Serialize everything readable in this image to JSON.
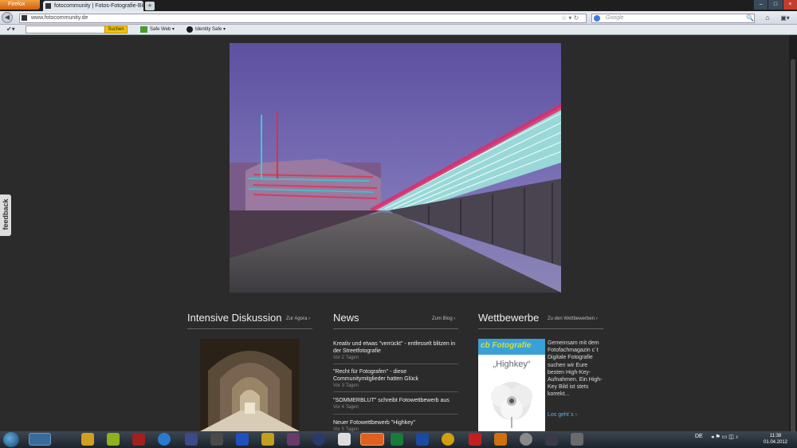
{
  "browser": {
    "app_button": "Firefox",
    "tab_title": "fotocommunity | Fotos-Fotografie-Bilde...",
    "new_tab": "+",
    "url": "www.fotocommunity.de",
    "search_placeholder": "Google"
  },
  "toolbar": {
    "search_button": "Suchen",
    "safe_web": "Safe Web ▾",
    "identity_safe": "Identity Safe ▾"
  },
  "page": {
    "feedback_tab": "feedback",
    "sections": {
      "discussion": {
        "title": "Intensive Diskussion",
        "link": "Zur Agora"
      },
      "news": {
        "title": "News",
        "link": "Zum Blog"
      },
      "contests": {
        "title": "Wettbewerbe",
        "link": "Zu den Wettbewerben"
      }
    },
    "news_items": [
      {
        "title": "Kreativ und etwas \"verrückt\" - entfesselt blitzen in der Streetfotografie",
        "date": "Vor 2 Tagen"
      },
      {
        "title": "\"Recht für Fotografen\" - diese Communitymitglieder hatten Glück",
        "date": "Vor 3 Tagen"
      },
      {
        "title": "\"SOMMERBLUT\" schreibt Fotowettbewerb aus",
        "date": "Vor 4 Tagen"
      },
      {
        "title": "Neuer Fotowettbewerb \"Highkey\"",
        "date": "Vor 5 Tagen"
      }
    ],
    "contest": {
      "logo_text": "Fotografie",
      "logo_prefix": "cb",
      "image_caption": "„Highkey“",
      "description": "Gemeinsam mit dem Fotofachmagazin c´t Digitale Fotografie suchen wir Eure besten High-Key-Aufnahmen. Ein High-Key Bild ist stets korrekt...",
      "more_link": "Los geht´s"
    }
  },
  "taskbar": {
    "language": "DE",
    "time": "11:38",
    "date": "01.04.2012"
  }
}
